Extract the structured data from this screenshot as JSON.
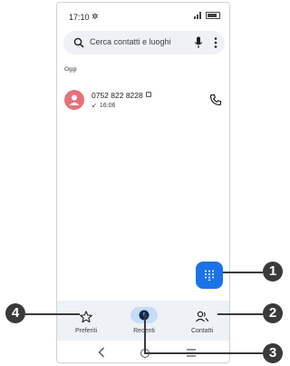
{
  "status_bar": {
    "time": "17:10"
  },
  "search": {
    "placeholder": "Cerca contatti e luoghi"
  },
  "section_label": "Oggi",
  "call_log": [
    {
      "number": "0752 822 8228",
      "time": "16:06",
      "direction": "incoming"
    }
  ],
  "bottom_nav": {
    "items": [
      {
        "label": "Preferiti",
        "icon": "star-icon"
      },
      {
        "label": "Recenti",
        "icon": "clock-icon",
        "selected": true
      },
      {
        "label": "Contatti",
        "icon": "contacts-icon"
      }
    ]
  },
  "callouts": [
    "1",
    "2",
    "3",
    "4"
  ],
  "colors": {
    "accent": "#1b73e8",
    "avatar": "#e8707a",
    "nav_bg": "#eef1f6",
    "selected_pill": "#c7dcf8"
  }
}
